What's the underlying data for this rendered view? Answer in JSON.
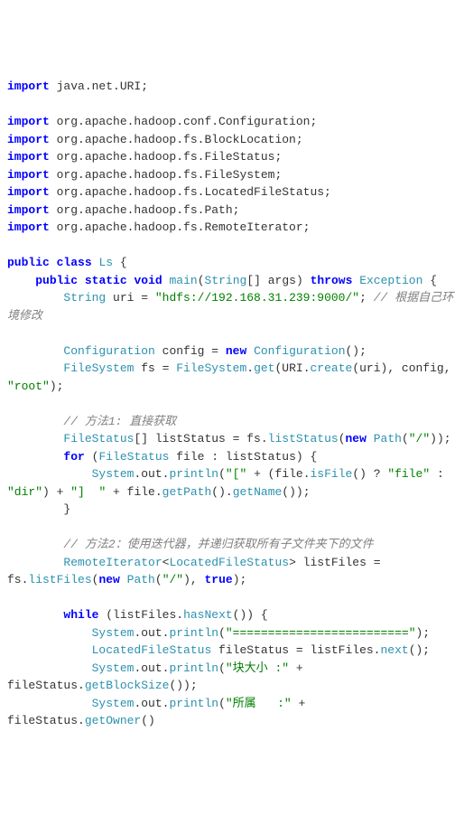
{
  "code": {
    "l1": {
      "kw": "import",
      "pkg": " java.net.URI;"
    },
    "l2": {
      "kw": "import",
      "pkg": " org.apache.hadoop.conf.Configuration;"
    },
    "l3": {
      "kw": "import",
      "pkg": " org.apache.hadoop.fs.BlockLocation;"
    },
    "l4": {
      "kw": "import",
      "pkg": " org.apache.hadoop.fs.FileStatus;"
    },
    "l5": {
      "kw": "import",
      "pkg": " org.apache.hadoop.fs.FileSystem;"
    },
    "l6": {
      "kw": "import",
      "pkg": " org.apache.hadoop.fs.LocatedFileStatus;"
    },
    "l7": {
      "kw": "import",
      "pkg": " org.apache.hadoop.fs.Path;"
    },
    "l8": {
      "kw": "import",
      "pkg": " org.apache.hadoop.fs.RemoteIterator;"
    },
    "l9": {
      "kw1": "public",
      "kw2": "class",
      "name": "Ls",
      "brace": " {"
    },
    "l10": {
      "kw1": "public",
      "kw2": "static",
      "kw3": "void",
      "name": "main",
      "p1": "(",
      "type": "String",
      "arr": "[] args) ",
      "kw4": "throws",
      "exc": "Exception",
      "brace": " {"
    },
    "l11": {
      "indent": "        ",
      "type": "String",
      "var": " uri = ",
      "str": "\"hdfs://192.168.31.239:9000/\"",
      "semi": "; ",
      "com": "// 根据自己环境修改"
    },
    "l12": {
      "indent": "        ",
      "type": "Configuration",
      "var": " config = ",
      "kw": "new",
      "type2": "Configuration",
      "rest": "();"
    },
    "l13": {
      "indent": "        ",
      "type": "FileSystem",
      "var": " fs = ",
      "type2": "FileSystem",
      "dot": ".",
      "mtd": "get",
      "p": "(URI.",
      "mtd2": "create",
      "rest": "(uri), config, ",
      "str": "\"root\"",
      "end": ");"
    },
    "l14": {
      "indent": "        ",
      "com": "// 方法1: 直接获取"
    },
    "l15": {
      "indent": "        ",
      "type": "FileStatus",
      "arr": "[] listStatus = fs.",
      "mtd": "listStatus",
      "p": "(",
      "kw": "new",
      "type2": "Path",
      "p2": "(",
      "str": "\"/\"",
      "end": "));"
    },
    "l16": {
      "indent": "        ",
      "kw": "for",
      "p": " (",
      "type": "FileStatus",
      "rest": " file : listStatus) {"
    },
    "l17": {
      "indent": "            ",
      "sys": "System",
      "dot": ".out.",
      "mtd": "println",
      "p": "(",
      "str1": "\"[\"",
      "plus": " + (file.",
      "mtd2": "isFile",
      "p2": "() ? ",
      "str2": "\"file\"",
      "colon": " : ",
      "str3": "\"dir\"",
      "rest": ") + ",
      "str4": "\"]  \"",
      "plus2": " + file.",
      "mtd3": "getPath",
      "p3": "().",
      "mtd4": "getName",
      "end": "());"
    },
    "l18": {
      "indent": "        }",
      "text": ""
    },
    "l19": {
      "indent": "        ",
      "com": "// 方法2：使用迭代器，并递归获取所有子文件夹下的文件"
    },
    "l20": {
      "indent": "        ",
      "type": "RemoteIterator",
      "lt": "<",
      "type2": "LocatedFileStatus",
      "gt": "> listFiles = fs.",
      "mtd": "listFiles",
      "p": "(",
      "kw": "new",
      "type3": "Path",
      "p2": "(",
      "str": "\"/\"",
      "rest": "), ",
      "kw2": "true",
      "end": ");"
    },
    "l21": {
      "indent": "        ",
      "kw": "while",
      "rest": " (listFiles.",
      "mtd": "hasNext",
      "end": "()) {"
    },
    "l22": {
      "indent": "            ",
      "sys": "System",
      "dot": ".out.",
      "mtd": "println",
      "p": "(",
      "str": "\"=========================\"",
      "end": ");"
    },
    "l23": {
      "indent": "            ",
      "type": "LocatedFileStatus",
      "rest": " fileStatus = listFiles.",
      "mtd": "next",
      "end": "();"
    },
    "l24": {
      "indent": "            ",
      "sys": "System",
      "dot": ".out.",
      "mtd": "println",
      "p": "(",
      "str": "\"块大小 :\"",
      "rest": " + fileStatus.",
      "mtd2": "getBlockSize",
      "end": "());"
    },
    "l25": {
      "indent": "            ",
      "sys": "System",
      "dot": ".out.",
      "mtd": "println",
      "p": "(",
      "str": "\"所属   :\"",
      "rest": " + fileStatus.",
      "mtd2": "getOwner",
      "end": "()"
    }
  }
}
